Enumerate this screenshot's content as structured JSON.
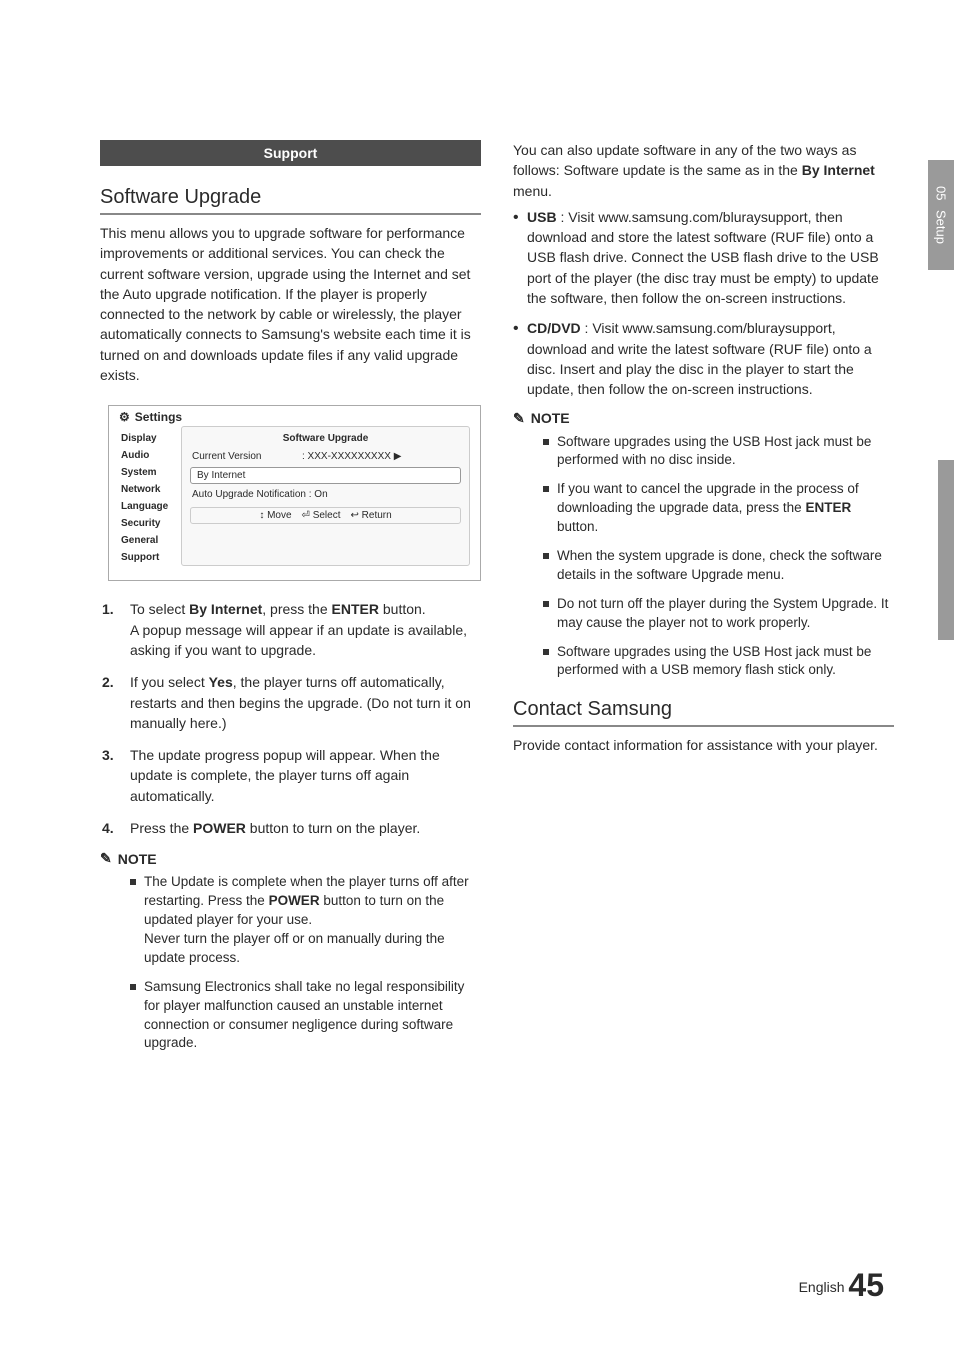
{
  "sideTab": {
    "chapter": "05",
    "label": "Setup"
  },
  "sectionHeader": "Support",
  "left": {
    "h2_1": "Software Upgrade",
    "intro": "This menu allows you to upgrade software for performance improvements or additional services. You can check the current software version, upgrade using the Internet and set the Auto upgrade notification. If the player is properly connected to the network by cable or wirelessly, the player automatically connects to Samsung's website each time it is turned on and downloads update files if any valid upgrade exists.",
    "sshot": {
      "header": "Settings",
      "sidebar": [
        "Display",
        "Audio",
        "System",
        "Network",
        "Language",
        "Security",
        "General",
        "Support"
      ],
      "panelTitle": "Software Upgrade",
      "rows": {
        "cv_lbl": "Current Version",
        "cv_val": ": XXX-XXXXXXXXX  ▶",
        "bi_lbl": "By Internet",
        "au_lbl": "Auto Upgrade Notification : On"
      },
      "hints": {
        "move": "↕ Move",
        "select": "⏎ Select",
        "ret": "↩ Return"
      }
    },
    "steps": [
      {
        "n": "1.",
        "text_pre": "To select ",
        "b1": "By Internet",
        "mid": ", press the ",
        "b2": "ENTER",
        "text_post": " button.\nA popup message will appear if an update is available, asking if you want to upgrade."
      },
      {
        "n": "2.",
        "text_pre": "If you select ",
        "b1": "Yes",
        "text_post": ", the player turns off automatically, restarts and then begins the upgrade. (Do not turn it on manually here.)"
      },
      {
        "n": "3.",
        "text_post": "The update progress popup will appear. When the update is complete, the player turns off again automatically."
      },
      {
        "n": "4.",
        "text_pre": "Press the ",
        "b1": "POWER",
        "text_post": " button to turn on the player."
      }
    ],
    "noteLabel": "NOTE",
    "notes": [
      {
        "pre": "The Update is complete when the player turns off after restarting. Press the ",
        "b": "POWER",
        "post": " button to turn on the updated player for your use.\nNever turn the player off or on manually during the update process."
      },
      {
        "pre": "Samsung Electronics shall take no legal responsibility for player malfunction caused an unstable internet connection or consumer negligence during software upgrade."
      }
    ]
  },
  "right": {
    "intro_pre": "You can also update software in any of the two ways as follows: Software update is the same as in the ",
    "intro_b": "By Internet",
    "intro_post": " menu.",
    "bullets": [
      {
        "b": "USB",
        "text": " : Visit www.samsung.com/bluraysupport, then download and store the latest software (RUF file) onto a USB flash drive. Connect the USB flash drive to the USB port of the player (the disc tray must be empty) to update the software, then follow the on-screen instructions."
      },
      {
        "b": "CD/DVD",
        "text": " : Visit www.samsung.com/bluraysupport, download and write the latest software (RUF file) onto a disc. Insert and play the disc in the player to start the update, then follow the on-screen instructions."
      }
    ],
    "noteLabel": "NOTE",
    "notes": [
      {
        "pre": "Software upgrades using the USB Host jack must be performed with no disc inside."
      },
      {
        "pre": "If you want to cancel the upgrade in the process of downloading the upgrade data, press the ",
        "b": "ENTER",
        "post": " button."
      },
      {
        "pre": "When the system upgrade is done, check the software details in the software Upgrade menu."
      },
      {
        "pre": "Do not turn off the player during the System Upgrade. It may cause the player not to work properly."
      },
      {
        "pre": "Software upgrades using the USB Host jack must be performed with a USB memory flash stick only."
      }
    ],
    "h2_2": "Contact Samsung",
    "contact": "Provide contact information for assistance with your player."
  },
  "footer": {
    "lang": "English",
    "page": "45"
  }
}
